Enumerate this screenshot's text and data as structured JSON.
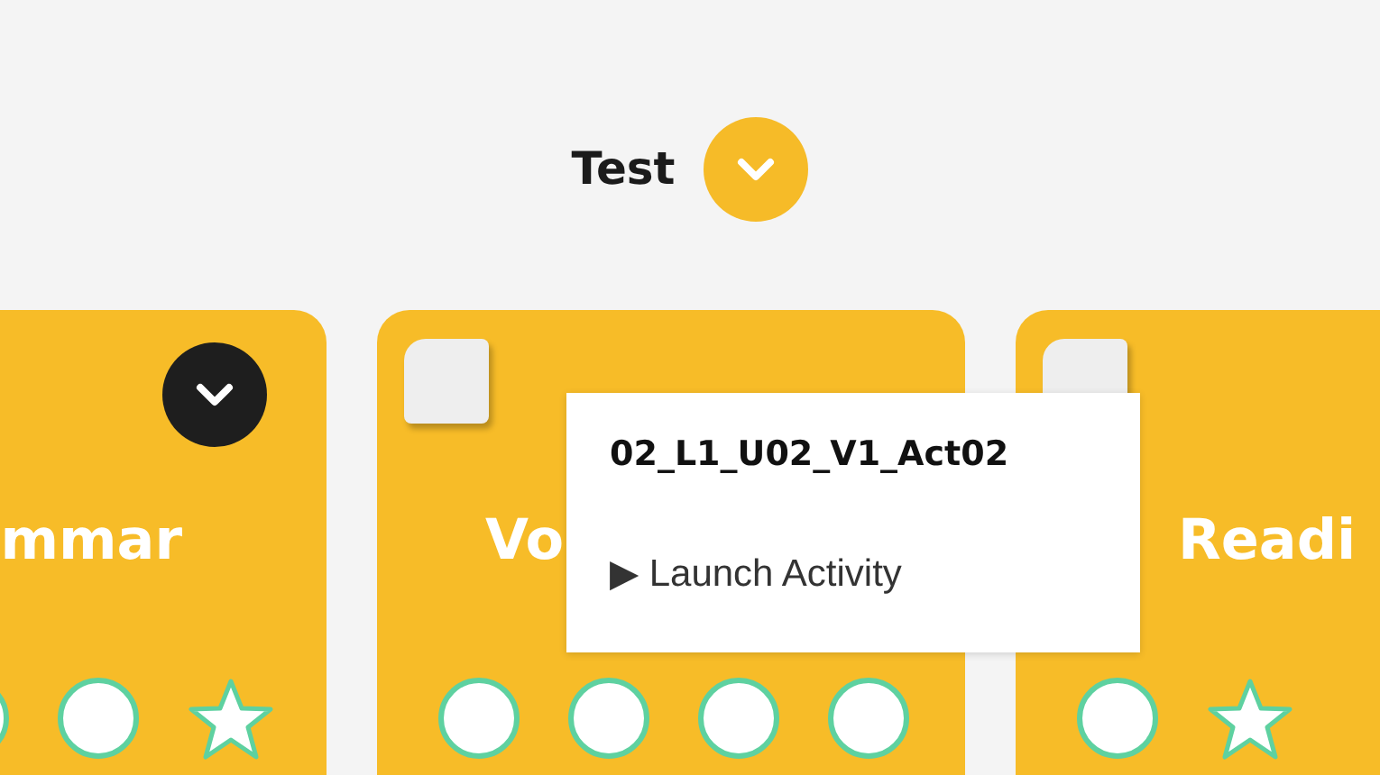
{
  "header": {
    "title": "Test"
  },
  "cards": [
    {
      "title": "mmar",
      "kind": "menu",
      "markers": [
        {
          "kind": "circle"
        },
        {
          "kind": "circle"
        },
        {
          "kind": "star"
        }
      ]
    },
    {
      "title": "Vo",
      "kind": "checkbox",
      "checked": false,
      "markers": [
        {
          "kind": "circle"
        },
        {
          "kind": "circle"
        },
        {
          "kind": "circle"
        },
        {
          "kind": "circle"
        }
      ]
    },
    {
      "title": "Readi",
      "kind": "checkbox",
      "checked": false,
      "markers": [
        {
          "kind": "circle"
        },
        {
          "kind": "star"
        }
      ]
    }
  ],
  "popup": {
    "title": "02_L1_U02_V1_Act02",
    "action": "▶ Launch Activity"
  }
}
